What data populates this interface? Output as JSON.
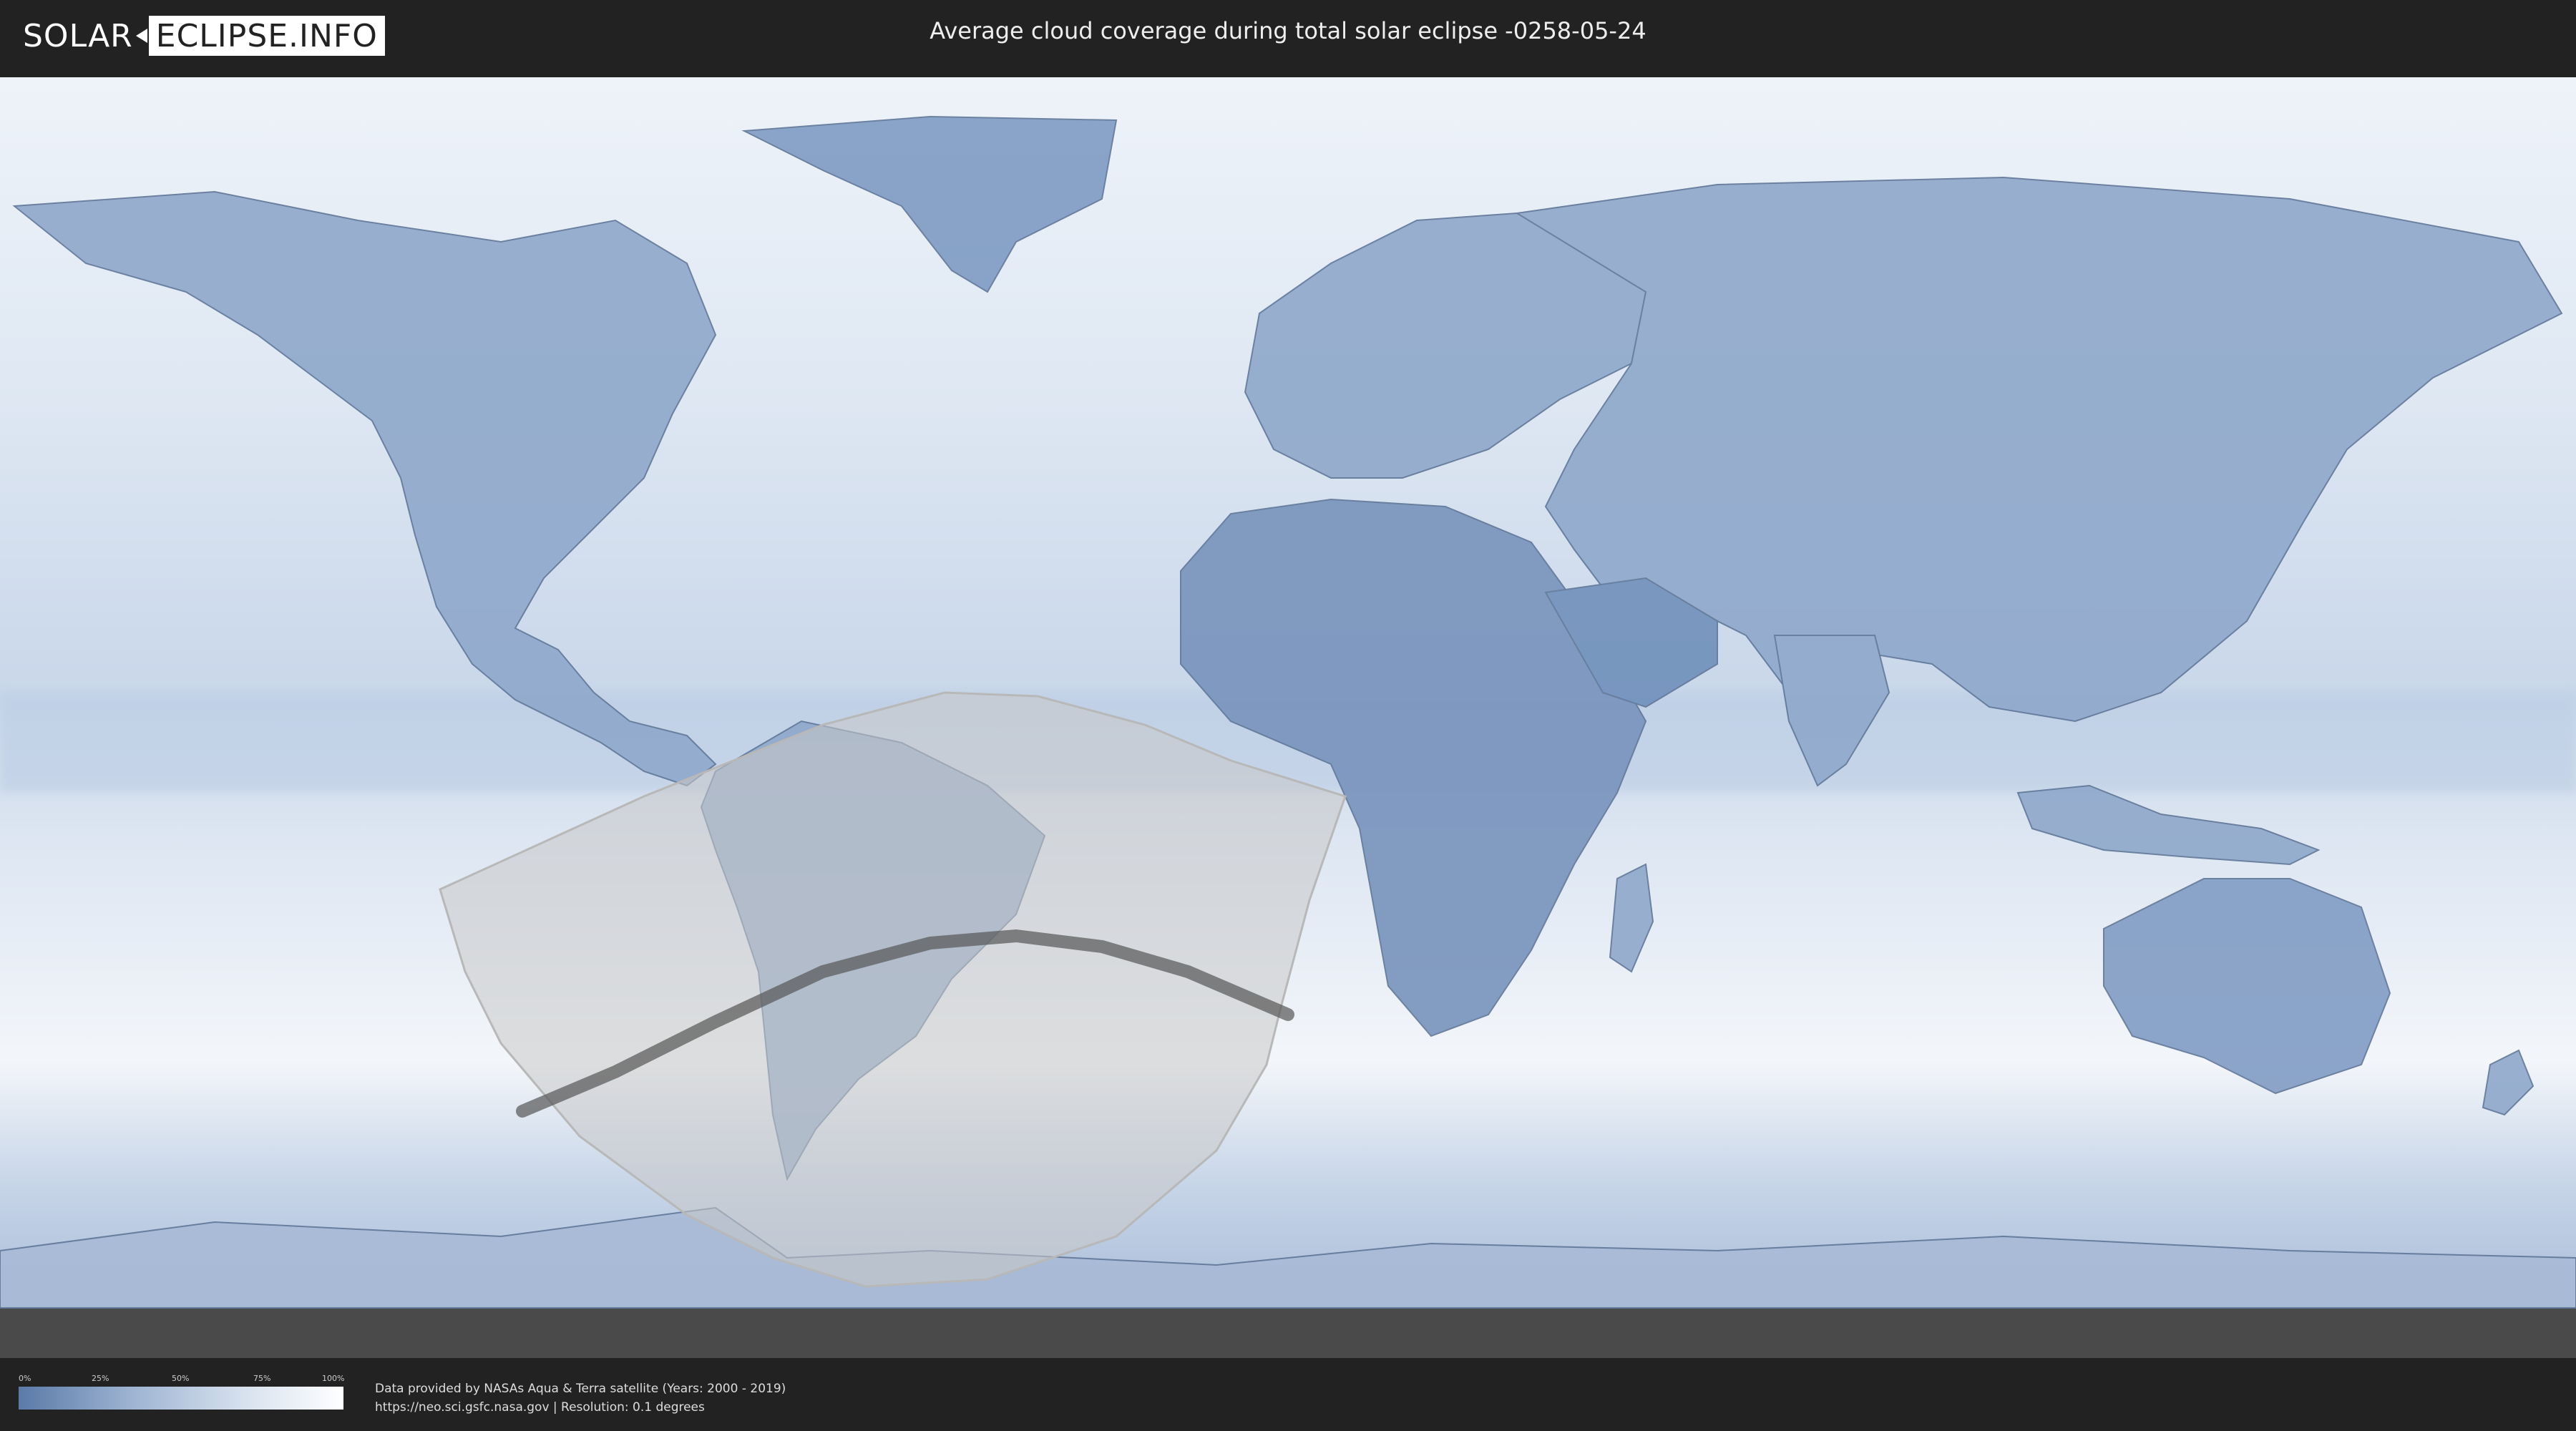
{
  "header": {
    "logo_left": "SOLAR",
    "logo_right": "ECLIPSE.INFO",
    "title": "Average cloud coverage during total solar eclipse -0258-05-24"
  },
  "legend": {
    "ticks": [
      "0%",
      "25%",
      "50%",
      "75%",
      "100%"
    ],
    "values": [
      0,
      25,
      50,
      75,
      100
    ],
    "colors": [
      "#5a7aa8",
      "#ffffff"
    ]
  },
  "footer": {
    "line1": "Data provided by NASAs Aqua & Terra satellite (Years: 2000 - 2019)",
    "line2": "https://neo.sci.gsfc.nasa.gov | Resolution: 0.1 degrees"
  },
  "map": {
    "projection": "equirectangular",
    "ocean_color": "#e6edf6",
    "land_color": "#8ca5c8",
    "eclipse_region_color": "#c8c8c8",
    "totality_path_color": "#555555"
  }
}
